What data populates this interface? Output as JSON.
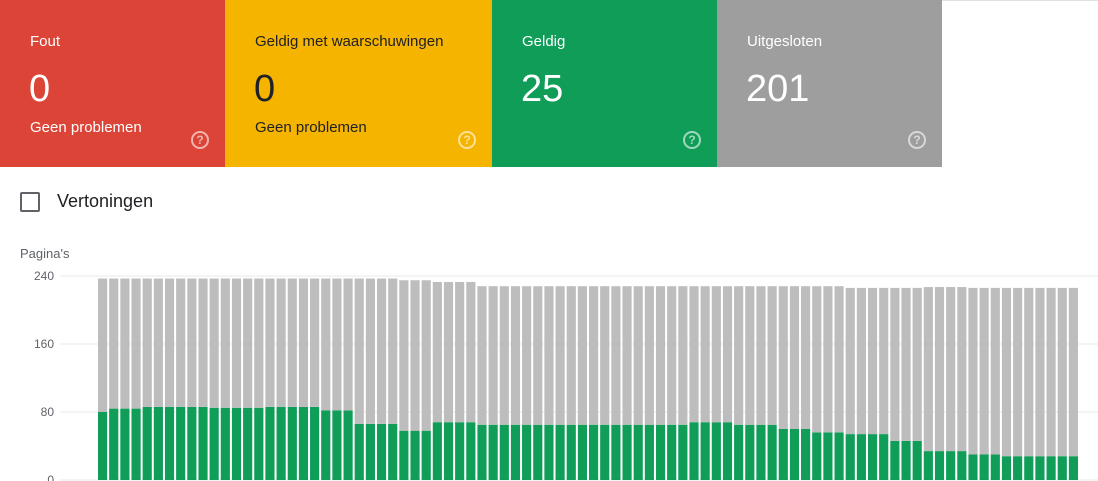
{
  "cards": [
    {
      "title": "Fout",
      "count": "0",
      "sub": "Geen problemen"
    },
    {
      "title": "Geldig met waarschuwingen",
      "count": "0",
      "sub": "Geen problemen"
    },
    {
      "title": "Geldig",
      "count": "25",
      "sub": ""
    },
    {
      "title": "Uitgesloten",
      "count": "201",
      "sub": ""
    }
  ],
  "help_icon": "help-circle-icon",
  "toggle": {
    "label": "Vertoningen",
    "checked": false
  },
  "chart_data": {
    "type": "bar",
    "stacked": true,
    "ylabel": "Pagina's",
    "ylim": [
      0,
      240
    ],
    "yticks": [
      "0",
      "80",
      "160",
      "240"
    ],
    "colors": {
      "valid": "#0f9d58",
      "excluded": "#bdbdbd"
    },
    "series": [
      {
        "name": "Geldig",
        "values": [
          80,
          84,
          84,
          84,
          86,
          86,
          86,
          86,
          86,
          86,
          85,
          85,
          85,
          85,
          85,
          86,
          86,
          86,
          86,
          86,
          82,
          82,
          82,
          66,
          66,
          66,
          66,
          58,
          58,
          58,
          68,
          68,
          68,
          68,
          65,
          65,
          65,
          65,
          65,
          65,
          65,
          65,
          65,
          65,
          65,
          65,
          65,
          65,
          65,
          65,
          65,
          65,
          65,
          68,
          68,
          68,
          68,
          65,
          65,
          65,
          65,
          60,
          60,
          60,
          56,
          56,
          56,
          54,
          54,
          54,
          54,
          46,
          46,
          46,
          34,
          34,
          34,
          34,
          30,
          30,
          30,
          28,
          28,
          28,
          28,
          28,
          28,
          28
        ]
      },
      {
        "name": "Uitgesloten",
        "values": [
          157,
          153,
          153,
          153,
          151,
          151,
          151,
          151,
          151,
          151,
          152,
          152,
          152,
          152,
          152,
          151,
          151,
          151,
          151,
          151,
          155,
          155,
          155,
          171,
          171,
          171,
          171,
          177,
          177,
          177,
          165,
          165,
          165,
          165,
          163,
          163,
          163,
          163,
          163,
          163,
          163,
          163,
          163,
          163,
          163,
          163,
          163,
          163,
          163,
          163,
          163,
          163,
          163,
          160,
          160,
          160,
          160,
          163,
          163,
          163,
          163,
          168,
          168,
          168,
          172,
          172,
          172,
          172,
          172,
          172,
          172,
          180,
          180,
          180,
          193,
          193,
          193,
          193,
          196,
          196,
          196,
          198,
          198,
          198,
          198,
          198,
          198,
          198
        ]
      }
    ]
  }
}
